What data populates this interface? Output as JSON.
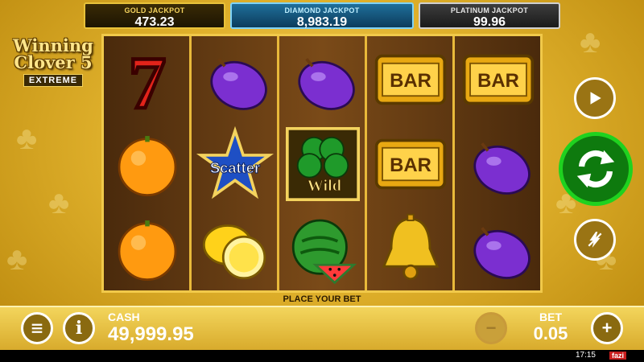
{
  "jackpots": {
    "gold": {
      "label": "GOLD JACKPOT",
      "value": "473.23"
    },
    "diamond": {
      "label": "DIAMOND JACKPOT",
      "value": "8,983.19"
    },
    "platinum": {
      "label": "PLATINUM JACKPOT",
      "value": "99.96"
    }
  },
  "logo": {
    "line1": "Winning",
    "line2": "Clover 5",
    "badge": "EXTREME"
  },
  "reels": [
    [
      "seven",
      "orange",
      "orange"
    ],
    [
      "plum",
      "scatter",
      "lemon"
    ],
    [
      "plum",
      "clover-wild",
      "watermelon"
    ],
    [
      "bar",
      "bar",
      "bell"
    ],
    [
      "bar",
      "plum",
      "plum"
    ]
  ],
  "symbol_text": {
    "bar": "BAR",
    "scatter": "Scatter",
    "wild": "Wild",
    "seven": "7"
  },
  "status": {
    "place_bet": "PLACE YOUR BET"
  },
  "cash": {
    "label": "CASH",
    "value": "49,999.95"
  },
  "bet": {
    "label": "BET",
    "value": "0.05"
  },
  "buttons": {
    "menu": "menu-icon",
    "info": "i",
    "minus": "−",
    "plus": "+"
  },
  "system": {
    "clock": "17:15",
    "brand": "fazi"
  },
  "colors": {
    "gold": "#e8c23a",
    "diamond": "#7fd3f7",
    "spin_green": "#1fd21f"
  }
}
